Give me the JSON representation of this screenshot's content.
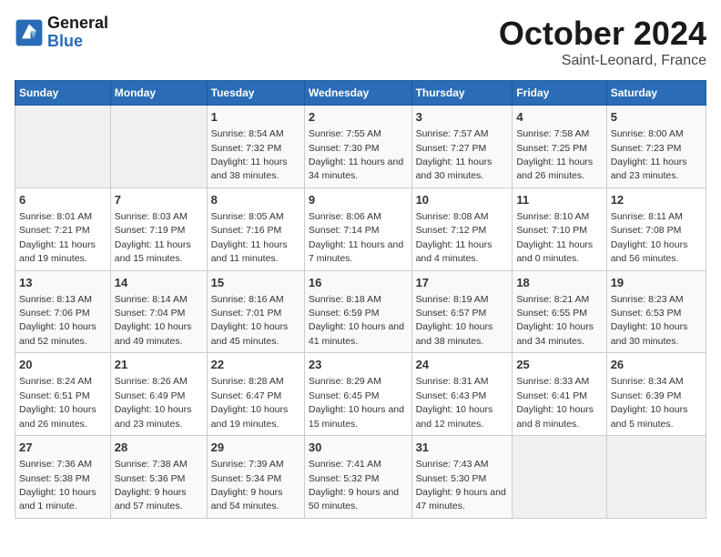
{
  "header": {
    "logo_line1": "General",
    "logo_line2": "Blue",
    "month_year": "October 2024",
    "location": "Saint-Leonard, France"
  },
  "weekdays": [
    "Sunday",
    "Monday",
    "Tuesday",
    "Wednesday",
    "Thursday",
    "Friday",
    "Saturday"
  ],
  "weeks": [
    [
      {
        "day": "",
        "empty": true
      },
      {
        "day": "",
        "empty": true
      },
      {
        "day": "1",
        "rise": "8:54 AM",
        "set": "7:32 PM",
        "daylight": "11 hours and 38 minutes."
      },
      {
        "day": "2",
        "rise": "7:55 AM",
        "set": "7:30 PM",
        "daylight": "11 hours and 34 minutes."
      },
      {
        "day": "3",
        "rise": "7:57 AM",
        "set": "7:27 PM",
        "daylight": "11 hours and 30 minutes."
      },
      {
        "day": "4",
        "rise": "7:58 AM",
        "set": "7:25 PM",
        "daylight": "11 hours and 26 minutes."
      },
      {
        "day": "5",
        "rise": "8:00 AM",
        "set": "7:23 PM",
        "daylight": "11 hours and 23 minutes."
      }
    ],
    [
      {
        "day": "6",
        "rise": "8:01 AM",
        "set": "7:21 PM",
        "daylight": "11 hours and 19 minutes."
      },
      {
        "day": "7",
        "rise": "8:03 AM",
        "set": "7:19 PM",
        "daylight": "11 hours and 15 minutes."
      },
      {
        "day": "8",
        "rise": "8:05 AM",
        "set": "7:16 PM",
        "daylight": "11 hours and 11 minutes."
      },
      {
        "day": "9",
        "rise": "8:06 AM",
        "set": "7:14 PM",
        "daylight": "11 hours and 7 minutes."
      },
      {
        "day": "10",
        "rise": "8:08 AM",
        "set": "7:12 PM",
        "daylight": "11 hours and 4 minutes."
      },
      {
        "day": "11",
        "rise": "8:10 AM",
        "set": "7:10 PM",
        "daylight": "11 hours and 0 minutes."
      },
      {
        "day": "12",
        "rise": "8:11 AM",
        "set": "7:08 PM",
        "daylight": "10 hours and 56 minutes."
      }
    ],
    [
      {
        "day": "13",
        "rise": "8:13 AM",
        "set": "7:06 PM",
        "daylight": "10 hours and 52 minutes."
      },
      {
        "day": "14",
        "rise": "8:14 AM",
        "set": "7:04 PM",
        "daylight": "10 hours and 49 minutes."
      },
      {
        "day": "15",
        "rise": "8:16 AM",
        "set": "7:01 PM",
        "daylight": "10 hours and 45 minutes."
      },
      {
        "day": "16",
        "rise": "8:18 AM",
        "set": "6:59 PM",
        "daylight": "10 hours and 41 minutes."
      },
      {
        "day": "17",
        "rise": "8:19 AM",
        "set": "6:57 PM",
        "daylight": "10 hours and 38 minutes."
      },
      {
        "day": "18",
        "rise": "8:21 AM",
        "set": "6:55 PM",
        "daylight": "10 hours and 34 minutes."
      },
      {
        "day": "19",
        "rise": "8:23 AM",
        "set": "6:53 PM",
        "daylight": "10 hours and 30 minutes."
      }
    ],
    [
      {
        "day": "20",
        "rise": "8:24 AM",
        "set": "6:51 PM",
        "daylight": "10 hours and 26 minutes."
      },
      {
        "day": "21",
        "rise": "8:26 AM",
        "set": "6:49 PM",
        "daylight": "10 hours and 23 minutes."
      },
      {
        "day": "22",
        "rise": "8:28 AM",
        "set": "6:47 PM",
        "daylight": "10 hours and 19 minutes."
      },
      {
        "day": "23",
        "rise": "8:29 AM",
        "set": "6:45 PM",
        "daylight": "10 hours and 15 minutes."
      },
      {
        "day": "24",
        "rise": "8:31 AM",
        "set": "6:43 PM",
        "daylight": "10 hours and 12 minutes."
      },
      {
        "day": "25",
        "rise": "8:33 AM",
        "set": "6:41 PM",
        "daylight": "10 hours and 8 minutes."
      },
      {
        "day": "26",
        "rise": "8:34 AM",
        "set": "6:39 PM",
        "daylight": "10 hours and 5 minutes."
      }
    ],
    [
      {
        "day": "27",
        "rise": "7:36 AM",
        "set": "5:38 PM",
        "daylight": "10 hours and 1 minute."
      },
      {
        "day": "28",
        "rise": "7:38 AM",
        "set": "5:36 PM",
        "daylight": "9 hours and 57 minutes."
      },
      {
        "day": "29",
        "rise": "7:39 AM",
        "set": "5:34 PM",
        "daylight": "9 hours and 54 minutes."
      },
      {
        "day": "30",
        "rise": "7:41 AM",
        "set": "5:32 PM",
        "daylight": "9 hours and 50 minutes."
      },
      {
        "day": "31",
        "rise": "7:43 AM",
        "set": "5:30 PM",
        "daylight": "9 hours and 47 minutes."
      },
      {
        "day": "",
        "empty": true
      },
      {
        "day": "",
        "empty": true
      }
    ]
  ]
}
